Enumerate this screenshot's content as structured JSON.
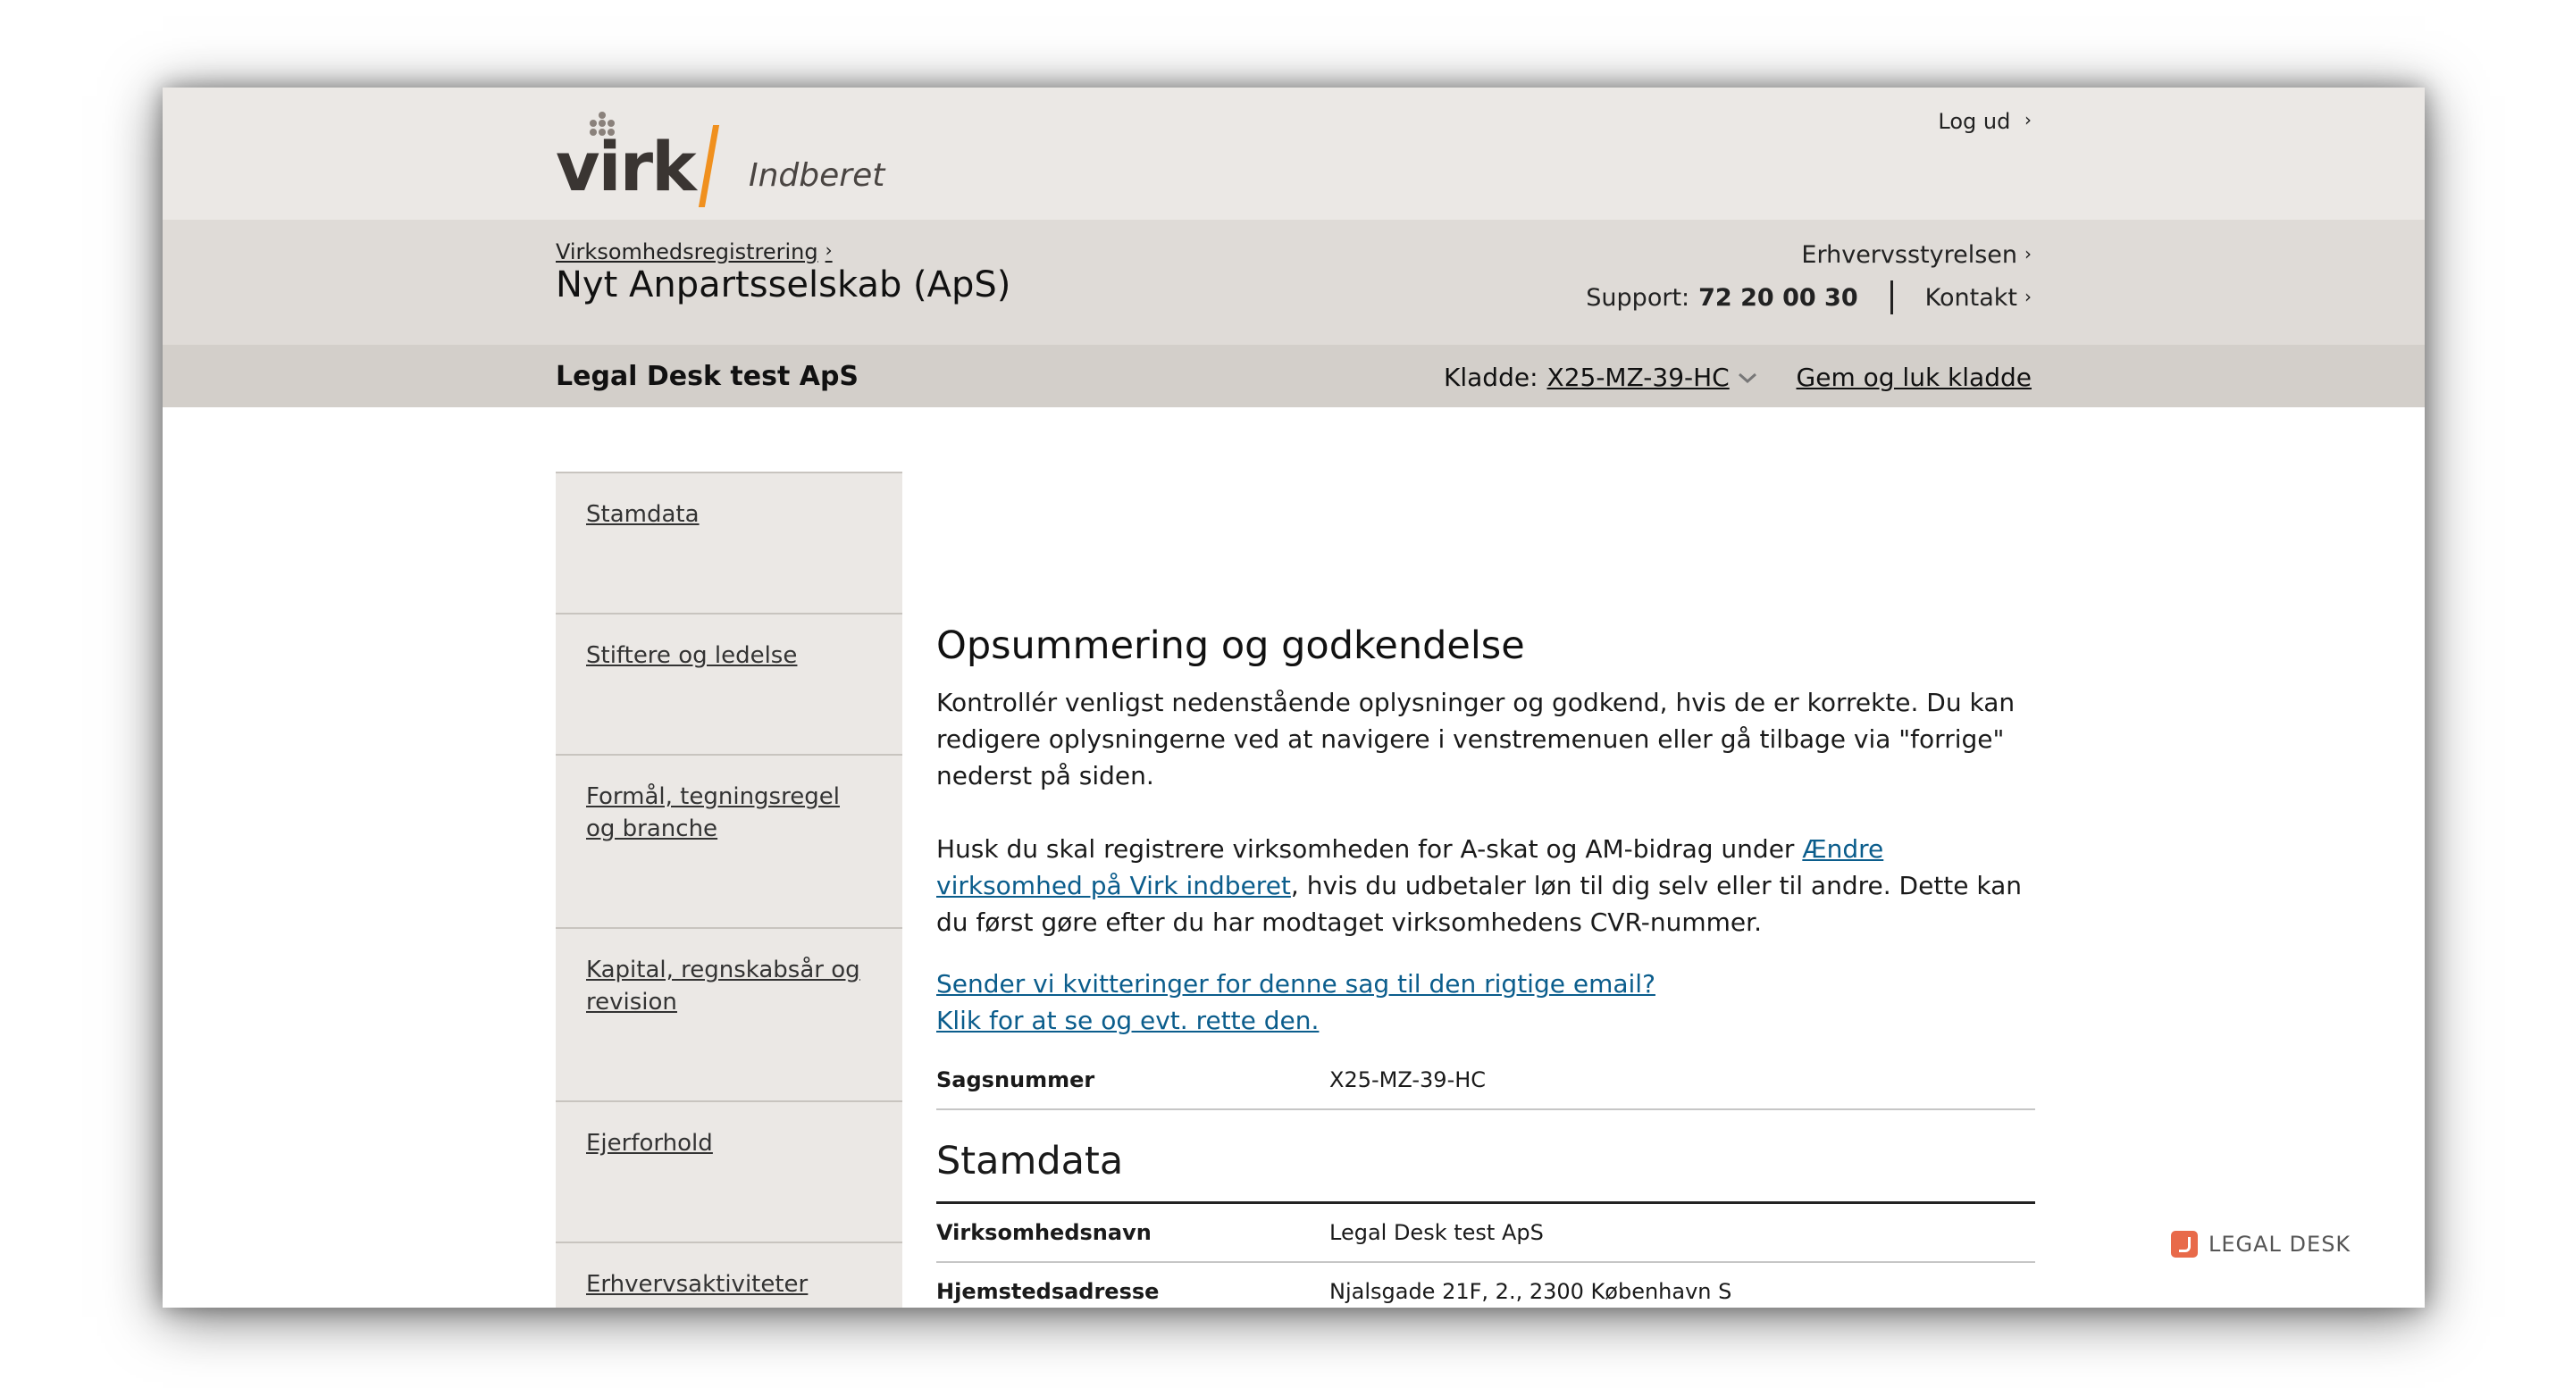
{
  "header": {
    "logo_text": "virk",
    "logo_sub": "Indberet",
    "logout": "Log ud",
    "logout_chevron": "›"
  },
  "subheader": {
    "breadcrumb": "Virksomhedsregistrering",
    "title": "Nyt Anpartsselskab (ApS)",
    "authority": "Erhvervsstyrelsen",
    "support_label": "Support:",
    "support_number": "72 20 00 30",
    "contact": "Kontakt",
    "chevron": "›"
  },
  "company_bar": {
    "company": "Legal Desk test ApS",
    "kladde_label": "Kladde:",
    "kladde_code": "X25-MZ-39-HC",
    "save_close": "Gem og luk kladde"
  },
  "sidebar": {
    "items": [
      {
        "label": "Stamdata"
      },
      {
        "label": "Stiftere og ledelse"
      },
      {
        "label": "Formål, tegningsregel og branche"
      },
      {
        "label": "Kapital, regnskabsår og revision"
      },
      {
        "label": "Ejerforhold"
      },
      {
        "label": "Erhvervsaktiviteter"
      }
    ]
  },
  "main": {
    "title": "Opsummering og godkendelse",
    "intro": "Kontrollér venligst nedenstående oplysninger og godkend, hvis de er korrekte. Du kan redigere oplysningerne ved at navigere i venstremenuen eller gå tilbage via \"forrige\" nederst på siden.",
    "askat_before": "Husk du skal registrere virksomheden for A-skat og AM-bidrag under ",
    "askat_link": "Ændre virksomhed på Virk indberet",
    "askat_after": ", hvis du udbetaler løn til dig selv eller til andre. Dette kan du først gøre efter du har modtaget virksomhedens CVR-nummer.",
    "email_link_1": "Sender vi kvitteringer for denne sag til den rigtige email?",
    "email_link_2": "Klik for at se og evt. rette den.",
    "case_label": "Sagsnummer",
    "case_value": "X25-MZ-39-HC",
    "section_title": "Stamdata",
    "rows": [
      {
        "k": "Virksomhedsnavn",
        "v": "Legal Desk test ApS"
      },
      {
        "k": "Hjemstedsadresse",
        "v": "Njalsgade 21F, 2., 2300 København S"
      }
    ]
  },
  "badge": {
    "text": "LEGAL DESK"
  },
  "colors": {
    "accent": "#f0901e",
    "link": "#0b5d8c",
    "badge": "#e86a4a"
  }
}
